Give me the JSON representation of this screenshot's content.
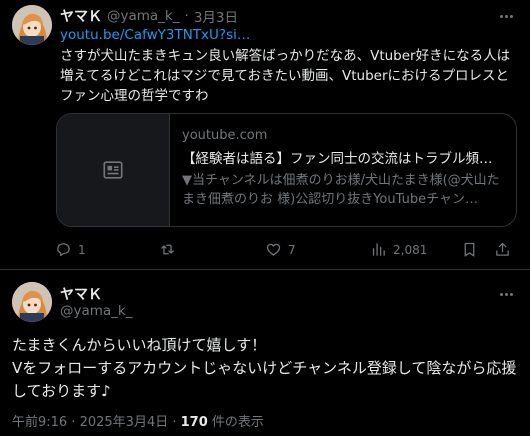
{
  "tweet": {
    "author_name": "ヤマＫ",
    "handle": "@yama_k_",
    "separator": "·",
    "date": "3月3日",
    "link_text": "youtu.be/CafwY3TNTxU?si…",
    "text": "さすが犬山たまきキュン良い解答ばっかりだなあ、Vtuber好きになる人は増えてるけどこれはマジで見ておきたい動画、Vtuberにおけるプロレスとファン心理の哲学ですわ",
    "card": {
      "domain": "youtube.com",
      "title": "【経験者は語る】ファン同士の交流はトラブル頻発…",
      "description": "▼当チャンネルは佃煮のりお様/犬山たまき様(@犬山たまき佃煮のりお 様)公認切り抜きYouTubeチャン…",
      "thumb_icon": "news-article-icon"
    },
    "actions": {
      "replies": "1",
      "retweets": "",
      "likes": "7",
      "views": "2,081"
    }
  },
  "reply": {
    "author_name": "ヤマＫ",
    "handle": "@yama_k_",
    "line1": "たまきくんからいいね頂けて嬉しす！",
    "line2": "Vをフォローするアカウントじゃないけどチャンネル登録して陰ながら応援しております♪",
    "meta_time": "午前9:16 · 2025年3月4日 · ",
    "meta_views_count": "170",
    "meta_views_label": " 件の表示"
  },
  "colors": {
    "background": "#000000",
    "text": "#e7e9ea",
    "muted": "#71767b",
    "link": "#1d9bf0",
    "border": "#2f3336"
  }
}
